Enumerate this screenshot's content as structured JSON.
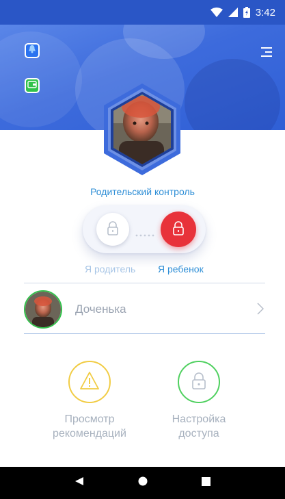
{
  "status_bar": {
    "time": "3:42",
    "icons": [
      "wifi-icon",
      "signal-icon",
      "battery-icon"
    ]
  },
  "header": {
    "notification_icon": "bell-icon",
    "wallet_icon": "wallet-icon",
    "menu_icon": "menu-icon"
  },
  "main": {
    "title": "Родительский контроль",
    "toggle": {
      "parent_label": "Я родитель",
      "child_label": "Я ребенок",
      "selected": "child"
    },
    "child_row": {
      "name": "Доченька"
    },
    "actions": [
      {
        "line1": "Просмотр",
        "line2": "рекомендаций",
        "icon": "warning-icon",
        "color": "#f1cc44"
      },
      {
        "line1": "Настройка",
        "line2": "доступа",
        "icon": "lock-icon",
        "color": "#4fd05f"
      }
    ]
  },
  "colors": {
    "brand_blue": "#2a56c6",
    "accent_text": "#2e8ed6",
    "lock_red": "#e8323a",
    "avatar_ring": "#33c04b"
  },
  "nav_bar": {
    "icons": [
      "back-icon",
      "home-icon",
      "recents-icon"
    ]
  }
}
